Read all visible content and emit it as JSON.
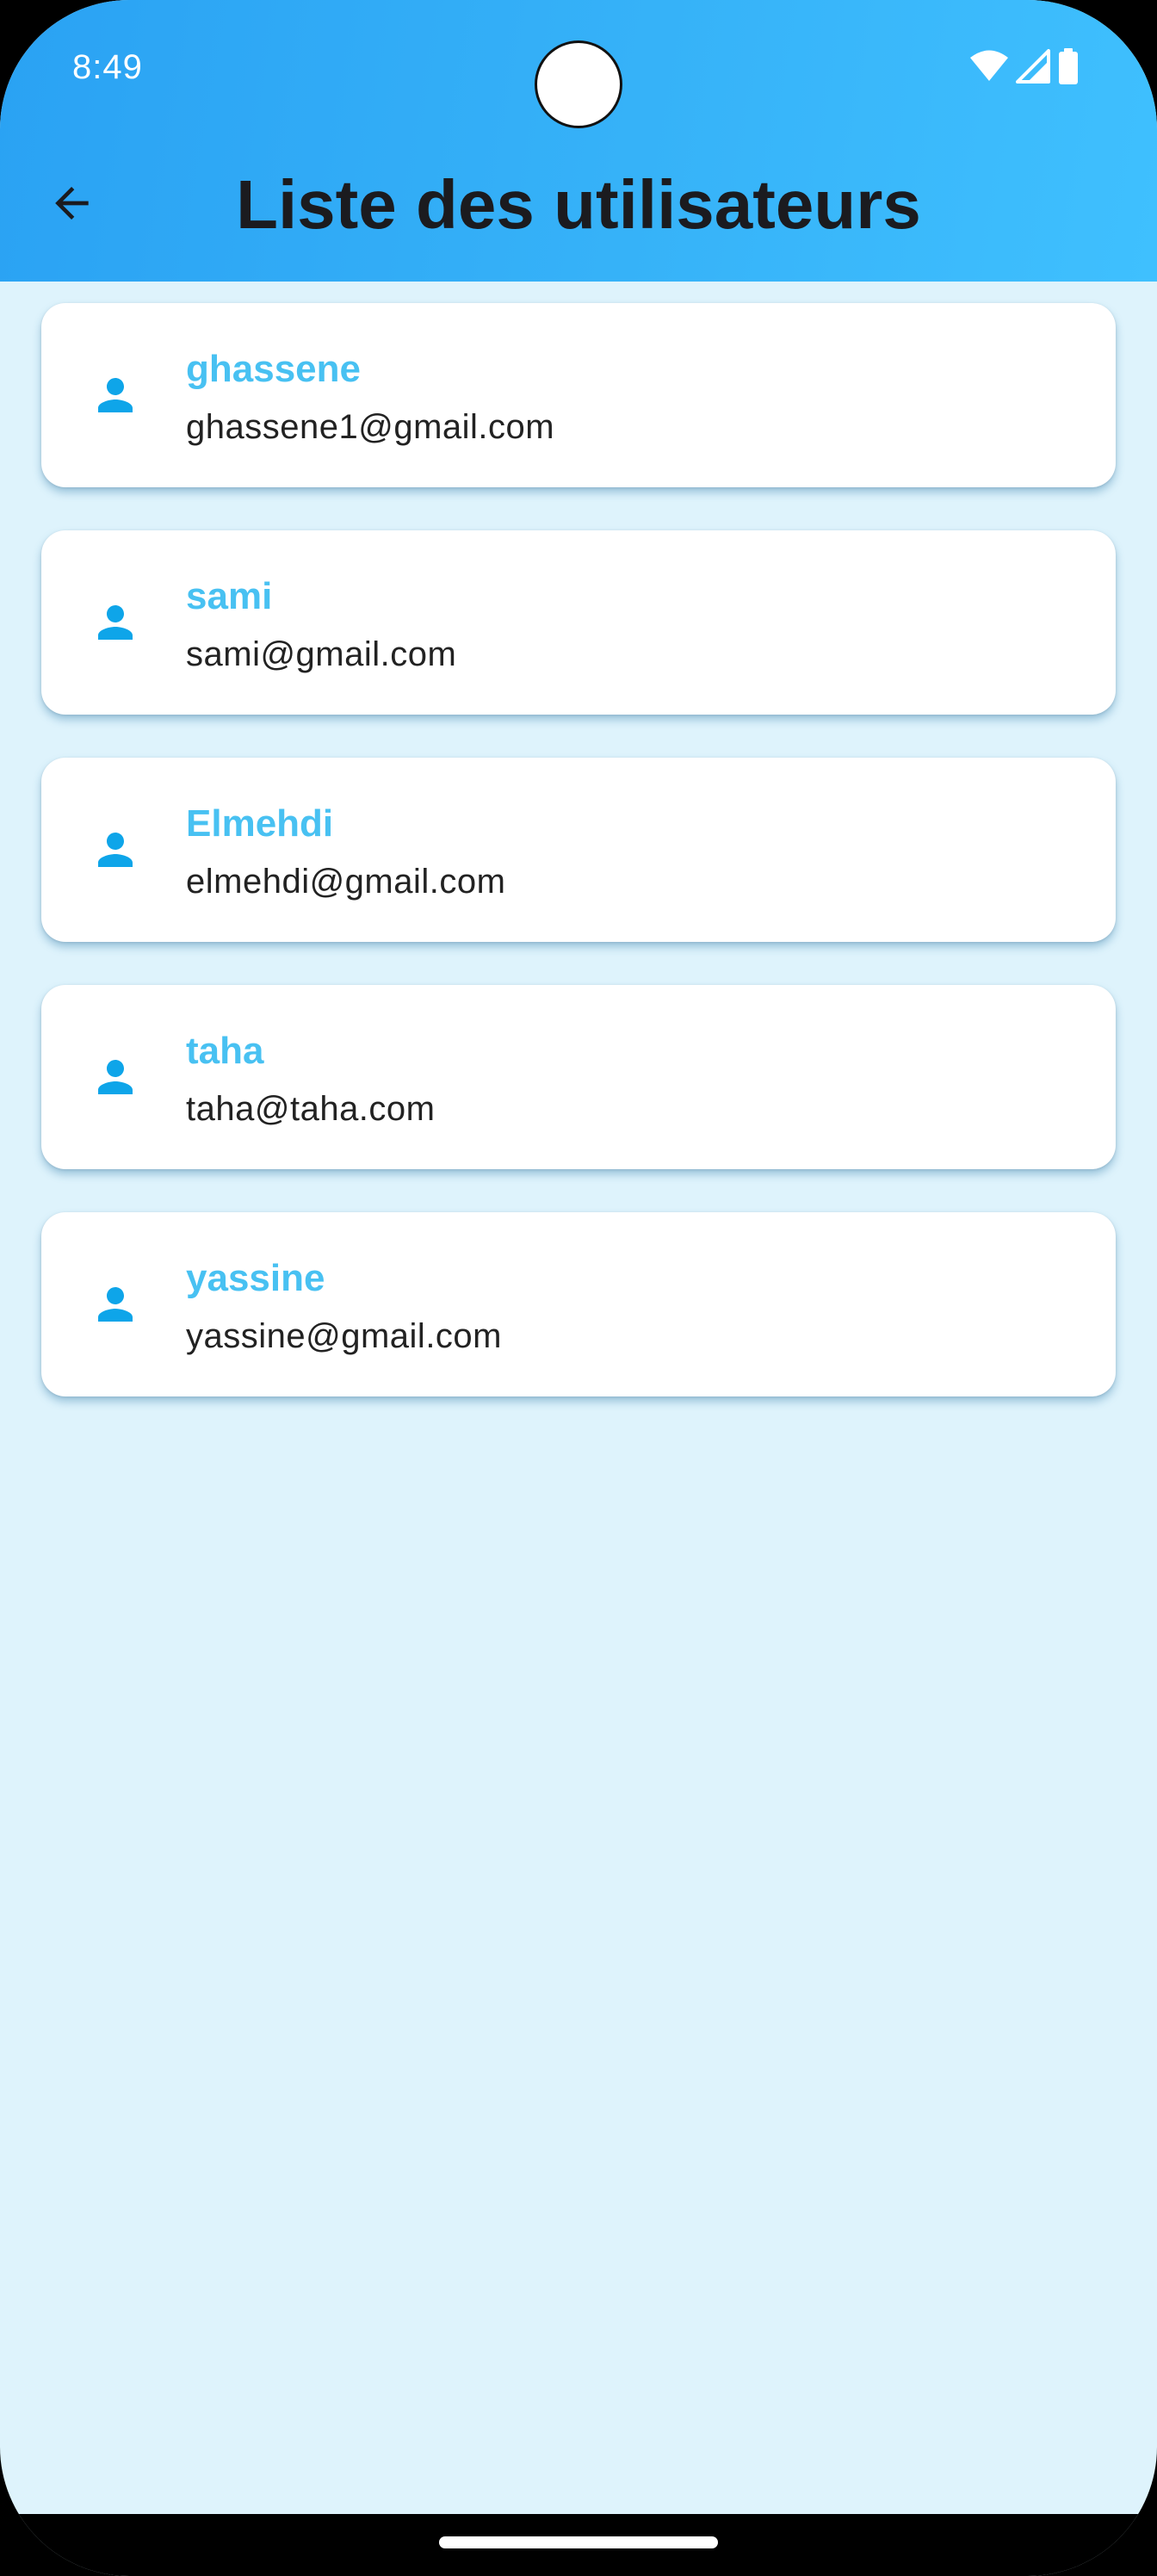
{
  "status_bar": {
    "time": "8:49",
    "icons": [
      "wifi-icon",
      "signal-icon",
      "battery-icon"
    ]
  },
  "app_bar": {
    "title": "Liste des utilisateurs",
    "back_icon": "arrow-back-icon"
  },
  "users": [
    {
      "name": "ghassene",
      "email": "ghassene1@gmail.com",
      "icon": "person-icon"
    },
    {
      "name": "sami",
      "email": "sami@gmail.com",
      "icon": "person-icon"
    },
    {
      "name": "Elmehdi",
      "email": "elmehdi@gmail.com",
      "icon": "person-icon"
    },
    {
      "name": "taha",
      "email": "taha@taha.com",
      "icon": "person-icon"
    },
    {
      "name": "yassine",
      "email": "yassine@gmail.com",
      "icon": "person-icon"
    }
  ],
  "colors": {
    "app_bar_start": "#2AA2F3",
    "app_bar_end": "#3FC0FE",
    "background": "#DEF3FC",
    "name_text": "#48C1F2",
    "icon": "#0EA5E9",
    "title_text": "#1B1B1F"
  }
}
